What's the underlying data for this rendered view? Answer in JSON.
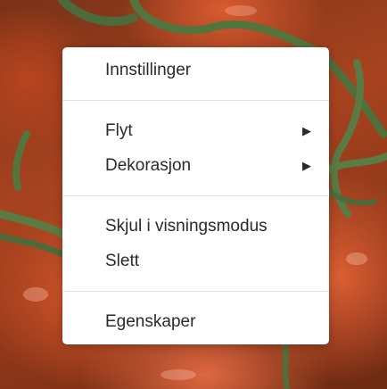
{
  "menu": {
    "groups": [
      {
        "items": [
          {
            "label": "Innstillinger",
            "has_submenu": false
          }
        ]
      },
      {
        "items": [
          {
            "label": "Flyt",
            "has_submenu": true,
            "arrow": "▶"
          },
          {
            "label": "Dekorasjon",
            "has_submenu": true,
            "arrow": "▶"
          }
        ]
      },
      {
        "items": [
          {
            "label": "Skjul i visningsmodus",
            "has_submenu": false
          },
          {
            "label": "Slett",
            "has_submenu": false
          }
        ]
      },
      {
        "items": [
          {
            "label": "Egenskaper",
            "has_submenu": false
          }
        ]
      }
    ]
  },
  "colors": {
    "menu_background": "#ffffff",
    "menu_text": "#2a2a2a",
    "separator": "#e3e3e3"
  }
}
